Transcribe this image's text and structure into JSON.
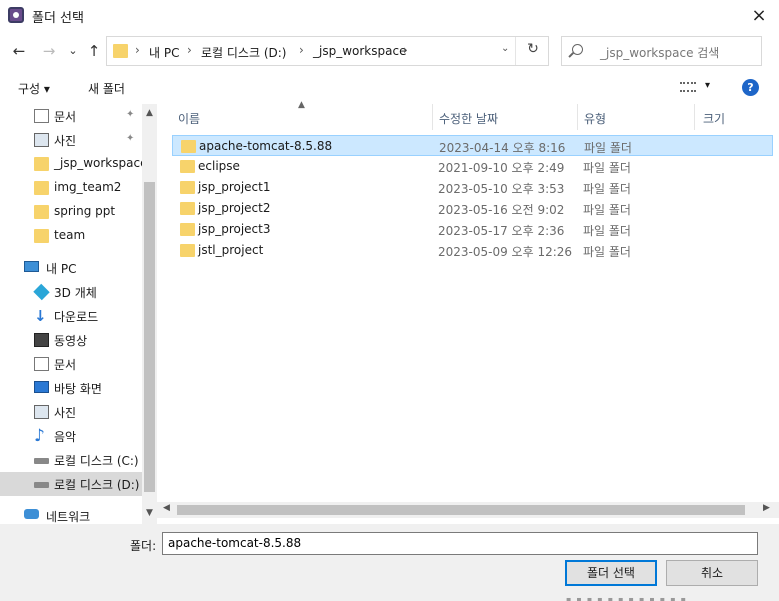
{
  "window": {
    "title": "폴더 선택",
    "close_icon": "×"
  },
  "nav": {
    "back_icon": "←",
    "forward_icon": "→",
    "recent_icon": "⌄",
    "up_icon": "↑",
    "breadcrumb": [
      "내 PC",
      "로컬 디스크 (D:)",
      "_jsp_workspace"
    ],
    "separator": "›",
    "dropdown_icon": "⌄",
    "refresh_icon": "↻",
    "search_placeholder": "_jsp_workspace 검색"
  },
  "toolbar": {
    "organize": "구성 ▾",
    "new_folder": "새 폴더",
    "view_dropdown": "▾",
    "help": "?"
  },
  "sidebar": {
    "items": [
      {
        "label": "문서",
        "icon": "document-icon",
        "pinned": true
      },
      {
        "label": "사진",
        "icon": "picture-icon",
        "pinned": true
      },
      {
        "label": "_jsp_workspace",
        "icon": "folder-icon"
      },
      {
        "label": "img_team2",
        "icon": "folder-icon"
      },
      {
        "label": "spring ppt",
        "icon": "folder-icon"
      },
      {
        "label": "team",
        "icon": "folder-icon"
      },
      {
        "label": "내 PC",
        "icon": "pc-icon"
      },
      {
        "label": "3D 개체",
        "icon": "3d-objects-icon"
      },
      {
        "label": "다운로드",
        "icon": "download-icon"
      },
      {
        "label": "동영상",
        "icon": "video-icon"
      },
      {
        "label": "문서",
        "icon": "document-icon"
      },
      {
        "label": "바탕 화면",
        "icon": "desktop-icon"
      },
      {
        "label": "사진",
        "icon": "picture-icon"
      },
      {
        "label": "음악",
        "icon": "music-icon"
      },
      {
        "label": "로컬 디스크 (C:)",
        "icon": "drive-icon"
      },
      {
        "label": "로컬 디스크 (D:)",
        "icon": "drive-icon",
        "selected": true
      },
      {
        "label": "네트워크",
        "icon": "network-icon"
      }
    ],
    "pin_icon": "📌"
  },
  "files": {
    "columns": [
      "이름",
      "수정한 날짜",
      "유형",
      "크기"
    ],
    "rows": [
      {
        "name": "apache-tomcat-8.5.88",
        "date": "2023-04-14 오후 8:16",
        "type": "파일 폴더",
        "selected": true
      },
      {
        "name": "eclipse",
        "date": "2021-09-10 오후 2:49",
        "type": "파일 폴더"
      },
      {
        "name": "jsp_project1",
        "date": "2023-05-10 오후 3:53",
        "type": "파일 폴더"
      },
      {
        "name": "jsp_project2",
        "date": "2023-05-16 오전 9:02",
        "type": "파일 폴더"
      },
      {
        "name": "jsp_project3",
        "date": "2023-05-17 오후 2:36",
        "type": "파일 폴더"
      },
      {
        "name": "jstl_project",
        "date": "2023-05-09 오후 12:26",
        "type": "파일 폴더"
      }
    ]
  },
  "footer": {
    "folder_label": "폴더:",
    "folder_value": "apache-tomcat-8.5.88",
    "select_button": "폴더 선택",
    "cancel_button": "취소"
  },
  "colors": {
    "selection": "#cce8ff",
    "folder": "#f7d36b",
    "accent": "#0078d7"
  }
}
